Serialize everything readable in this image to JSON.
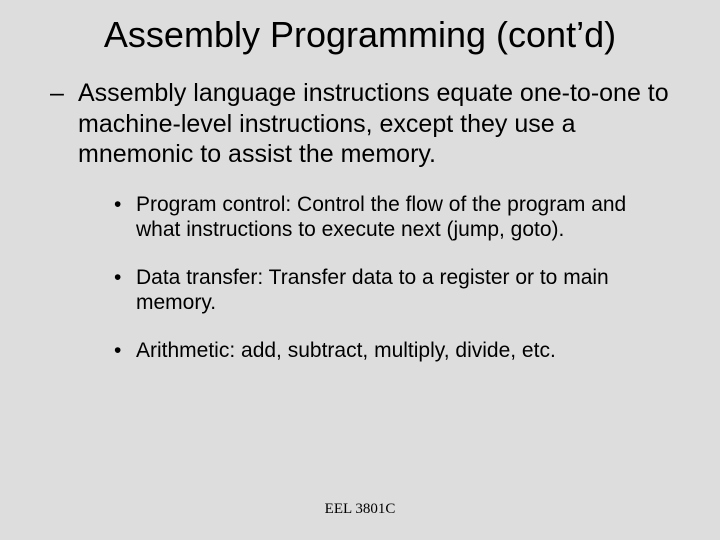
{
  "title": "Assembly Programming (cont’d)",
  "main_point": {
    "marker": "–",
    "text": "Assembly language instructions equate one-to-one to machine-level instructions, except they use a mnemonic to assist the memory."
  },
  "sub_points": [
    {
      "marker": "•",
      "text": "Program control: Control the flow of the program and what instructions to execute next (jump, goto)."
    },
    {
      "marker": "•",
      "text": "Data transfer: Transfer data to a register or to main memory."
    },
    {
      "marker": "•",
      "text": "Arithmetic: add, subtract, multiply, divide, etc."
    }
  ],
  "footer": "EEL 3801C"
}
